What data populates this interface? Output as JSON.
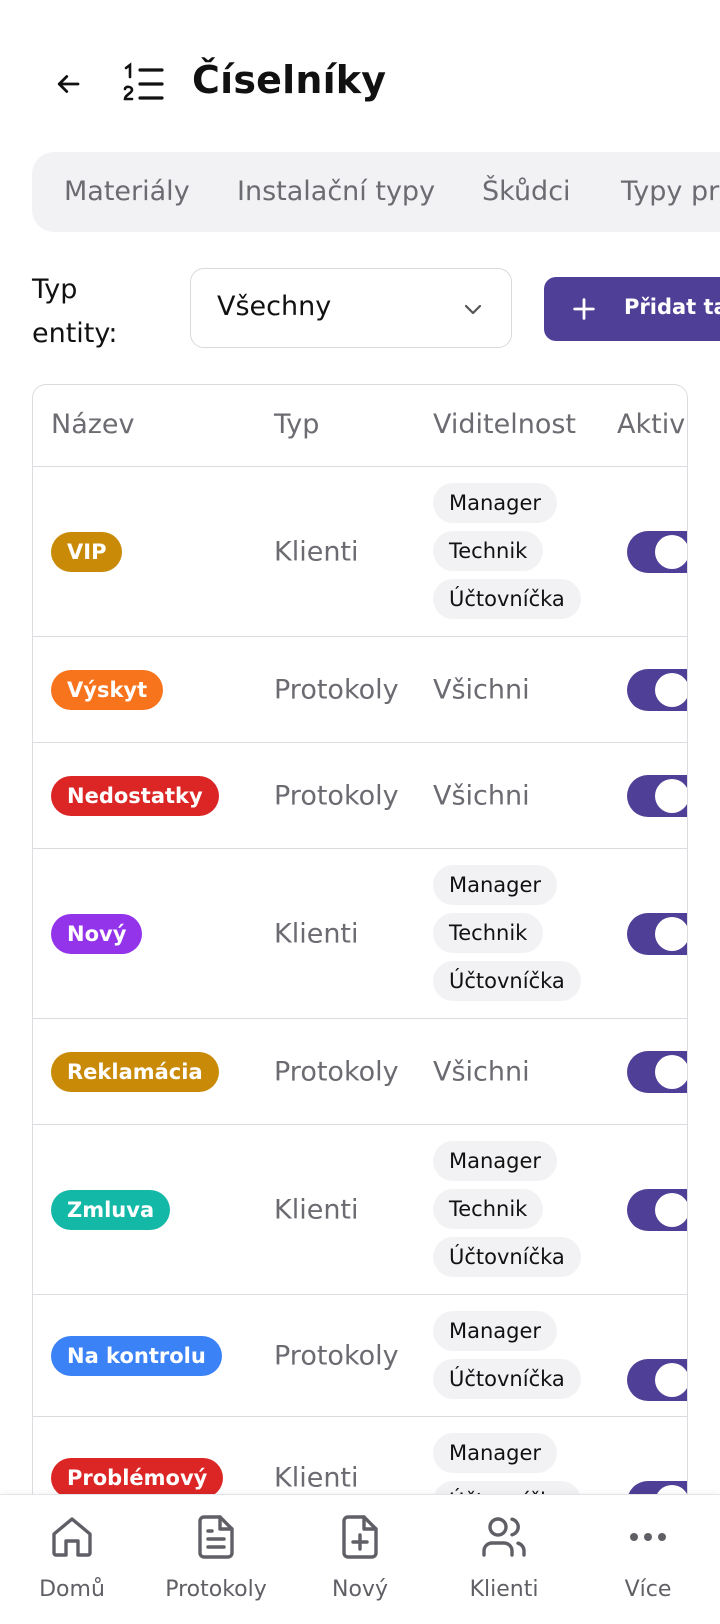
{
  "header": {
    "title": "Číselníky",
    "back_icon": "arrow-left-icon",
    "title_icon": "numbered-list-icon"
  },
  "tabs": [
    {
      "label": "Materiály"
    },
    {
      "label": "Instalační typy"
    },
    {
      "label": "Škůdci"
    },
    {
      "label": "Typy pr"
    }
  ],
  "filter": {
    "label": "Typ\nentity:",
    "select_value": "Všechny"
  },
  "add_button": {
    "label": "Přidat tag"
  },
  "table": {
    "columns": [
      "Název",
      "Typ",
      "Viditelnost",
      "Aktiv"
    ],
    "rows": [
      {
        "name": "VIP",
        "color": "#c98a08",
        "type": "Klienti",
        "visibility": [
          "Manager",
          "Technik",
          "Účtovníčka"
        ],
        "active": true
      },
      {
        "name": "Výskyt",
        "color": "#f7731c",
        "type": "Protokoly",
        "visibility_text": "Všichni",
        "active": true
      },
      {
        "name": "Nedostatky",
        "color": "#dc2626",
        "type": "Protokoly",
        "visibility_text": "Všichni",
        "active": true
      },
      {
        "name": "Nový",
        "color": "#9333ea",
        "type": "Klienti",
        "visibility": [
          "Manager",
          "Technik",
          "Účtovníčka"
        ],
        "active": true
      },
      {
        "name": "Reklamácia",
        "color": "#c98a08",
        "type": "Protokoly",
        "visibility_text": "Všichni",
        "active": true
      },
      {
        "name": "Zmluva",
        "color": "#14b8a6",
        "type": "Klienti",
        "visibility": [
          "Manager",
          "Technik",
          "Účtovníčka"
        ],
        "active": true
      },
      {
        "name": "Na kontrolu",
        "color": "#3b82f6",
        "type": "Protokoly",
        "visibility": [
          "Manager",
          "Účtovníčka"
        ],
        "active": true
      },
      {
        "name": "Problémový",
        "color": "#dc2626",
        "type": "Klienti",
        "visibility": [
          "Manager",
          "Účtovníčka"
        ],
        "active": true
      }
    ]
  },
  "bottom_nav": [
    {
      "label": "Domů",
      "icon": "home-icon"
    },
    {
      "label": "Protokoly",
      "icon": "document-icon"
    },
    {
      "label": "Nový",
      "icon": "file-plus-icon"
    },
    {
      "label": "Klienti",
      "icon": "users-icon"
    },
    {
      "label": "Více",
      "icon": "more-dots-icon"
    }
  ],
  "colors": {
    "accent": "#4f3f97",
    "muted_text": "#6b6b72",
    "tab_bg": "#f2f2f4"
  }
}
